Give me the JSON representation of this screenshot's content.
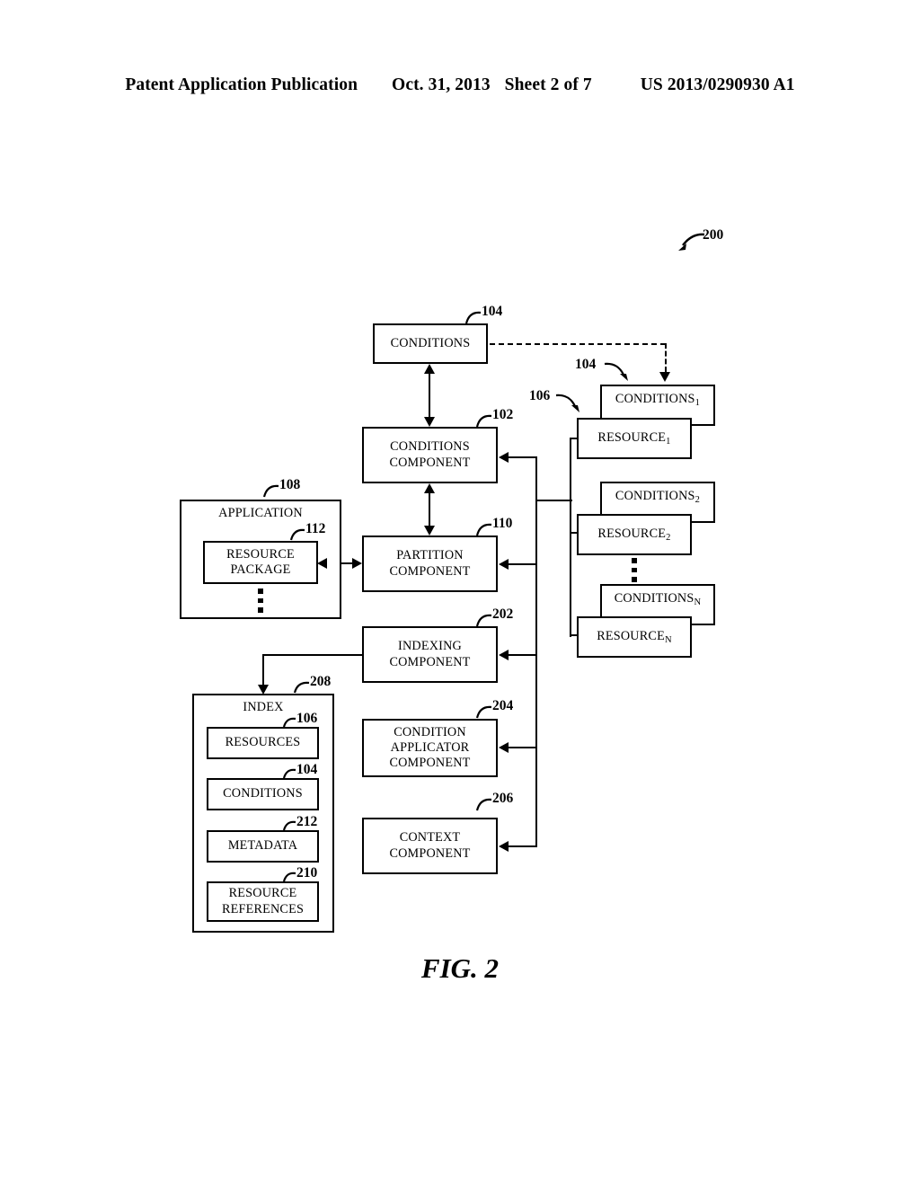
{
  "header": {
    "publication": "Patent Application Publication",
    "date": "Oct. 31, 2013",
    "sheet": "Sheet 2 of 7",
    "patent_number": "US 2013/0290930 A1"
  },
  "figure": {
    "caption": "FIG. 2",
    "system_ref": "200"
  },
  "blocks": {
    "conditions_top": {
      "label": "CONDITIONS",
      "ref": "104"
    },
    "conditions_component": {
      "line1": "CONDITIONS",
      "line2": "COMPONENT",
      "ref": "102"
    },
    "partition_component": {
      "line1": "PARTITION",
      "line2": "COMPONENT",
      "ref": "110"
    },
    "indexing_component": {
      "line1": "INDEXING",
      "line2": "COMPONENT",
      "ref": "202"
    },
    "condition_applicator_component": {
      "line1": "CONDITION",
      "line2": "APPLICATOR",
      "line3": "COMPONENT",
      "ref": "204"
    },
    "context_component": {
      "line1": "CONTEXT",
      "line2": "COMPONENT",
      "ref": "206"
    },
    "application": {
      "label": "APPLICATION",
      "ref": "108"
    },
    "resource_package": {
      "line1": "RESOURCE",
      "line2": "PACKAGE",
      "ref": "112"
    },
    "index": {
      "label": "INDEX",
      "ref": "208"
    },
    "index_resources": {
      "label": "RESOURCES",
      "ref": "106"
    },
    "index_conditions": {
      "label": "CONDITIONS",
      "ref": "104"
    },
    "index_metadata": {
      "label": "METADATA",
      "ref": "212"
    },
    "index_resource_references": {
      "line1": "RESOURCE",
      "line2": "REFERENCES",
      "ref": "210"
    }
  },
  "resource_groups": {
    "conditions_ref": "104",
    "resource_ref": "106",
    "items": [
      {
        "conditions_label": "CONDITIONS",
        "conditions_sub": "1",
        "resource_label": "RESOURCE",
        "resource_sub": "1"
      },
      {
        "conditions_label": "CONDITIONS",
        "conditions_sub": "2",
        "resource_label": "RESOURCE",
        "resource_sub": "2"
      },
      {
        "conditions_label": "CONDITIONS",
        "conditions_sub": "N",
        "resource_label": "RESOURCE",
        "resource_sub": "N"
      }
    ]
  },
  "colors": {
    "line": "#000000",
    "background": "#ffffff"
  }
}
